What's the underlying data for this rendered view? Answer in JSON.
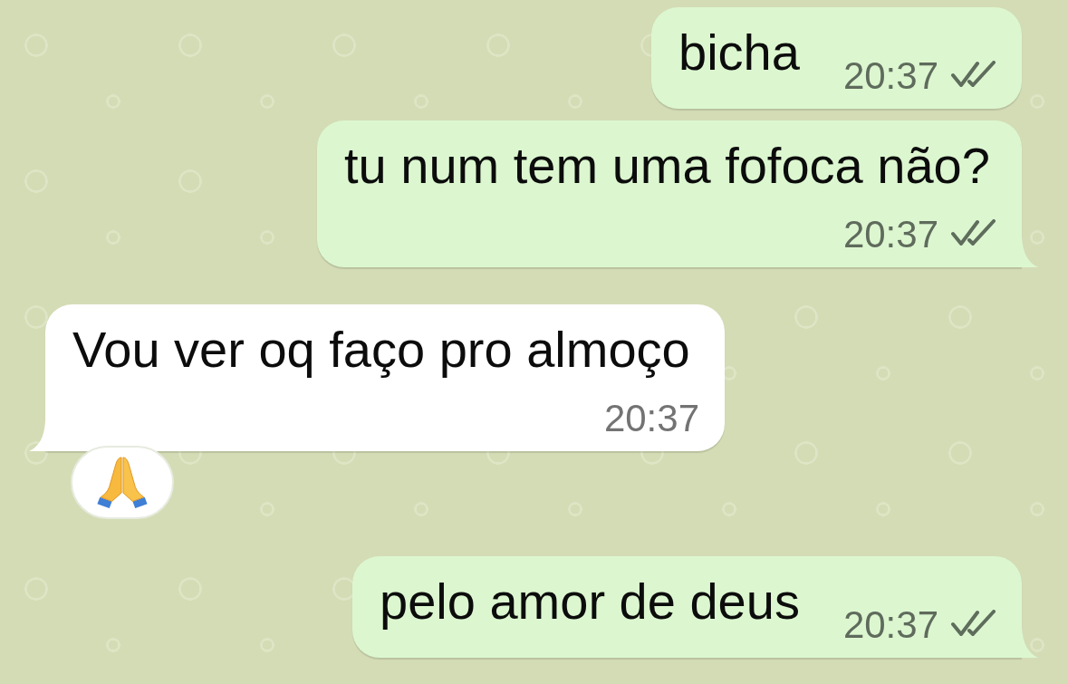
{
  "messages": [
    {
      "kind": "outgoing",
      "text": "bicha",
      "time": "20:37",
      "delivered": true,
      "read": false,
      "tail": false,
      "reacted": false
    },
    {
      "kind": "outgoing",
      "text": "tu num tem uma fofoca não?",
      "time": "20:37",
      "delivered": true,
      "read": false,
      "tail": true,
      "reacted": false
    },
    {
      "kind": "incoming",
      "text": "Vou ver oq faço pro almoço",
      "time": "20:37",
      "tail": true,
      "reacted": true
    },
    {
      "kind": "outgoing",
      "text": "pelo amor de deus",
      "time": "20:37",
      "delivered": true,
      "read": false,
      "tail": true,
      "reacted": false
    }
  ]
}
